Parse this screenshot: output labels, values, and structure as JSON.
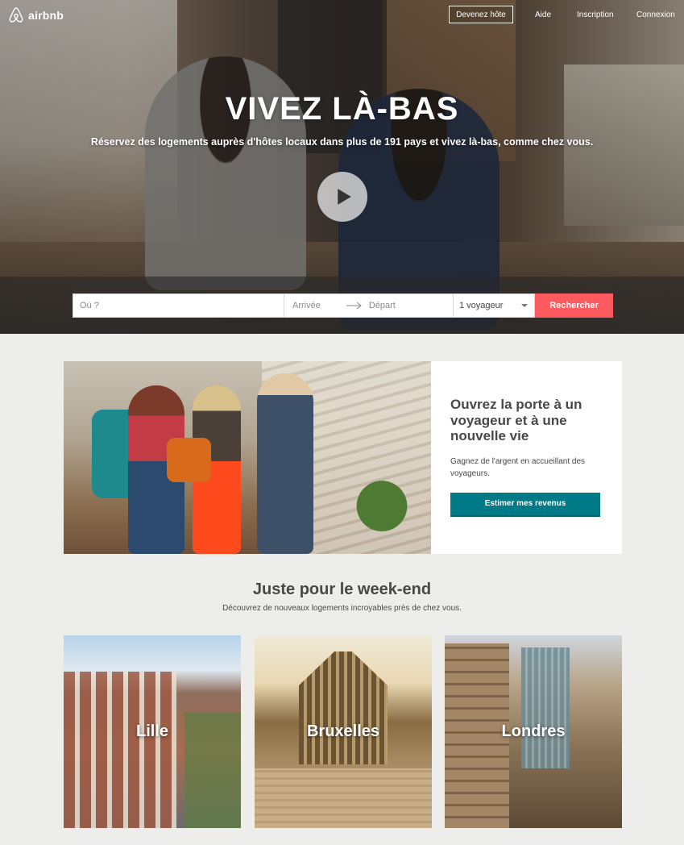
{
  "header": {
    "logo_text": "airbnb",
    "host_button": "Devenez hôte",
    "help_link": "Aide",
    "signup_link": "Inscription",
    "login_link": "Connexion"
  },
  "hero": {
    "title": "VIVEZ LÀ-BAS",
    "subtitle": "Réservez des logements auprès d'hôtes locaux dans plus de 191 pays et vivez là-bas, comme chez vous."
  },
  "search": {
    "where_placeholder": "Où ?",
    "checkin_placeholder": "Arrivée",
    "checkout_placeholder": "Départ",
    "guests_value": "1 voyageur",
    "submit_label": "Rechercher"
  },
  "promo": {
    "title": "Ouvrez la porte à un voyageur et à une nouvelle vie",
    "description": "Gagnez de l'argent en accueillant des voyageurs.",
    "button_label": "Estimer mes revenus"
  },
  "weekend": {
    "title": "Juste pour le week-end",
    "subtitle": "Découvrez de nouveaux logements incroyables près de chez vous.",
    "cities": [
      {
        "name": "Lille"
      },
      {
        "name": "Bruxelles"
      },
      {
        "name": "Londres"
      }
    ]
  },
  "colors": {
    "brand": "#ff5a5f",
    "teal_button": "#007a87",
    "page_bg": "#edeeeb"
  }
}
